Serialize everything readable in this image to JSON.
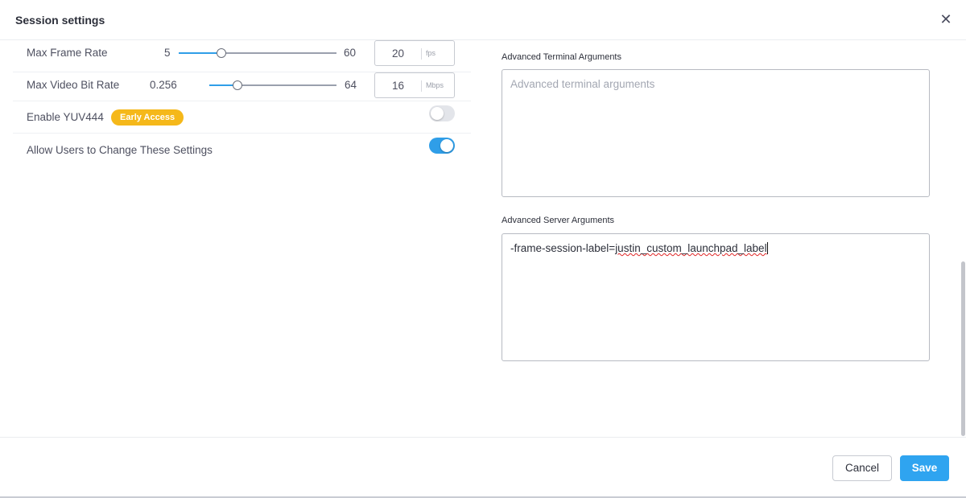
{
  "dialog": {
    "title": "Session settings",
    "close_glyph": "✕"
  },
  "settings": {
    "max_frame_rate": {
      "label": "Max Frame Rate",
      "min_label": "5",
      "max_label": "60",
      "value": "20",
      "unit": "fps",
      "slider_fraction": 0.27
    },
    "max_video_bit_rate": {
      "label": "Max Video Bit Rate",
      "min_label": "0.256",
      "max_label": "64",
      "value": "16",
      "unit": "Mbps",
      "slider_fraction": 0.22
    },
    "enable_yuv444": {
      "label": "Enable YUV444",
      "badge": "Early Access",
      "enabled": false
    },
    "allow_users_change": {
      "label": "Allow Users to Change These Settings",
      "enabled": true
    }
  },
  "advanced": {
    "terminal_label": "Advanced Terminal Arguments",
    "terminal_placeholder": "Advanced terminal arguments",
    "server_label": "Advanced Server Arguments",
    "server_value_prefix": "-frame-session-label=",
    "server_value_misspelled": "justin_custom_launchpad_label"
  },
  "footer": {
    "cancel_label": "Cancel",
    "save_label": "Save"
  },
  "colors": {
    "accent": "#2fa4f0",
    "badge": "#f5b81a"
  },
  "icons": {
    "close": "close-icon"
  }
}
